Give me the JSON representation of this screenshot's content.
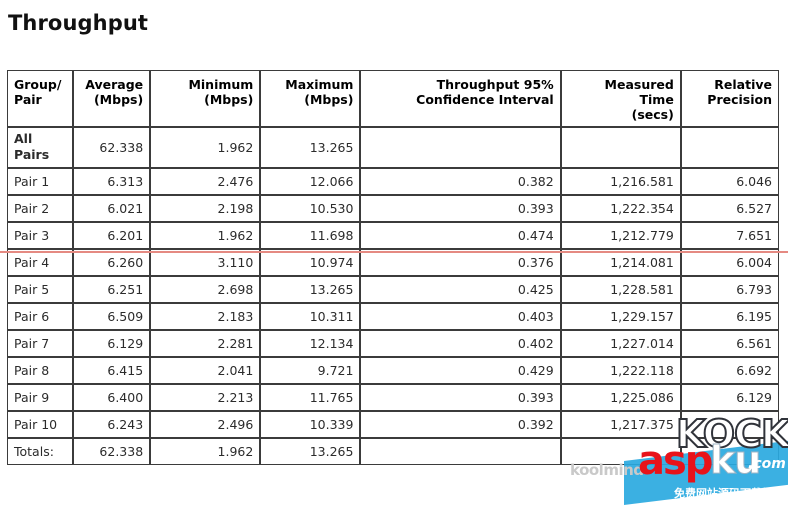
{
  "page": {
    "title": "Throughput"
  },
  "annotations": {
    "red_rule_color": "#e58a82",
    "red_rule_target_row": "Pair 3"
  },
  "watermark": {
    "kock": "KOCK",
    "asp": "asp",
    "ku": "ku",
    "com": ".com",
    "chinese": "免费网站源码下载站",
    "koolmind": "koolmind"
  },
  "table": {
    "columns": [
      {
        "key": "group",
        "label": "Group/\nPair",
        "line1": "Group/",
        "line2": "Pair",
        "align": "left"
      },
      {
        "key": "avg",
        "label": "Average (Mbps)",
        "line1": "Average",
        "line2": "(Mbps)",
        "align": "right"
      },
      {
        "key": "min",
        "label": "Minimum (Mbps)",
        "line1": "Minimum",
        "line2": "(Mbps)",
        "align": "right"
      },
      {
        "key": "max",
        "label": "Maximum (Mbps)",
        "line1": "Maximum",
        "line2": "(Mbps)",
        "align": "right"
      },
      {
        "key": "ci",
        "label": "Throughput 95% Confidence Interval",
        "line1": "Throughput 95%",
        "line2": "Confidence Interval",
        "align": "right"
      },
      {
        "key": "time",
        "label": "Measured Time (secs)",
        "line1": "Measured Time",
        "line2": "(secs)",
        "align": "right"
      },
      {
        "key": "prec",
        "label": "Relative Precision",
        "line1": "Relative",
        "line2": "Precision",
        "align": "right"
      }
    ],
    "rows": [
      {
        "group_line1": "All",
        "group_line2": "Pairs",
        "group": "All Pairs",
        "avg": "62.338",
        "min": "1.962",
        "max": "13.265",
        "ci": "",
        "time": "",
        "prec": "",
        "style": "allpairs"
      },
      {
        "group": "Pair 1",
        "avg": "6.313",
        "min": "2.476",
        "max": "12.066",
        "ci": "0.382",
        "time": "1,216.581",
        "prec": "6.046",
        "style": "normal"
      },
      {
        "group": "Pair 2",
        "avg": "6.021",
        "min": "2.198",
        "max": "10.530",
        "ci": "0.393",
        "time": "1,222.354",
        "prec": "6.527",
        "style": "normal"
      },
      {
        "group": "Pair 3",
        "avg": "6.201",
        "min": "1.962",
        "max": "11.698",
        "ci": "0.474",
        "time": "1,212.779",
        "prec": "7.651",
        "style": "normal"
      },
      {
        "group": "Pair 4",
        "avg": "6.260",
        "min": "3.110",
        "max": "10.974",
        "ci": "0.376",
        "time": "1,214.081",
        "prec": "6.004",
        "style": "normal"
      },
      {
        "group": "Pair 5",
        "avg": "6.251",
        "min": "2.698",
        "max": "13.265",
        "ci": "0.425",
        "time": "1,228.581",
        "prec": "6.793",
        "style": "normal"
      },
      {
        "group": "Pair 6",
        "avg": "6.509",
        "min": "2.183",
        "max": "10.311",
        "ci": "0.403",
        "time": "1,229.157",
        "prec": "6.195",
        "style": "normal"
      },
      {
        "group": "Pair 7",
        "avg": "6.129",
        "min": "2.281",
        "max": "12.134",
        "ci": "0.402",
        "time": "1,227.014",
        "prec": "6.561",
        "style": "normal"
      },
      {
        "group": "Pair 8",
        "avg": "6.415",
        "min": "2.041",
        "max": "9.721",
        "ci": "0.429",
        "time": "1,222.118",
        "prec": "6.692",
        "style": "normal"
      },
      {
        "group": "Pair 9",
        "avg": "6.400",
        "min": "2.213",
        "max": "11.765",
        "ci": "0.393",
        "time": "1,225.086",
        "prec": "6.129",
        "style": "normal"
      },
      {
        "group": "Pair 10",
        "avg": "6.243",
        "min": "2.496",
        "max": "10.339",
        "ci": "0.392",
        "time": "1,217.375",
        "prec": "",
        "style": "normal"
      },
      {
        "group": "Totals:",
        "avg": "62.338",
        "min": "1.962",
        "max": "13.265",
        "ci": "",
        "time": "",
        "prec": "",
        "style": "totals"
      }
    ]
  }
}
